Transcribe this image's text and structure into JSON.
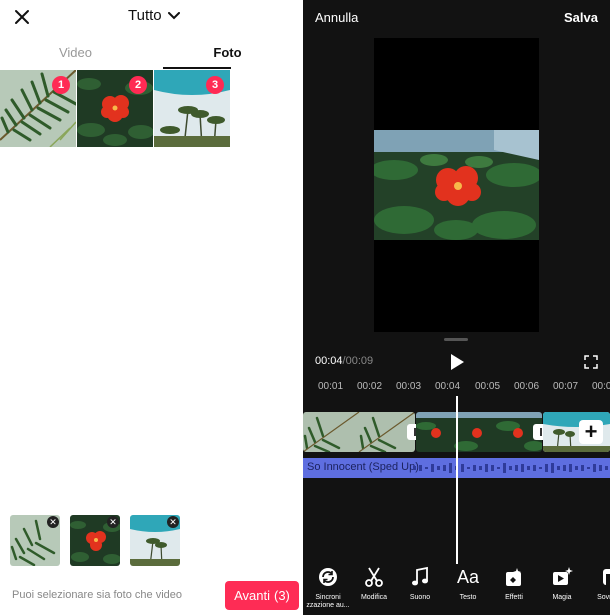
{
  "picker": {
    "album": "Tutto",
    "tabs": [
      {
        "label": "Video",
        "active": false
      },
      {
        "label": "Foto",
        "active": true
      }
    ],
    "photos": [
      {
        "thumb": "palm-leaves",
        "order": "1"
      },
      {
        "thumb": "red-hibiscus",
        "order": "2"
      },
      {
        "thumb": "beach-palms",
        "order": "3"
      }
    ],
    "hint": "Puoi selezionare sia foto che video",
    "next_label": "Avanti",
    "next_count": "(3)",
    "accent": "#fe2c55"
  },
  "editor": {
    "cancel": "Annulla",
    "save": "Salva",
    "time_current": "00:04",
    "time_total": "/00:09",
    "ruler_ticks": [
      "00:01",
      "00:02",
      "00:03",
      "00:04",
      "00:05",
      "00:06",
      "00:07",
      "00:0"
    ],
    "audio_title": "So Innocent (Sped Up)",
    "audio_color": "#5e6ee0",
    "tools": [
      {
        "icon": "sync-icon",
        "label": "Sincroni\nzzazione au..."
      },
      {
        "icon": "scissors-icon",
        "label": "Modifica"
      },
      {
        "icon": "music-note-icon",
        "label": "Suono"
      },
      {
        "icon": "text-icon",
        "label": "Testo",
        "glyph": "Aa"
      },
      {
        "icon": "effects-icon",
        "label": "Effetti"
      },
      {
        "icon": "magic-icon",
        "label": "Magia"
      },
      {
        "icon": "overlay-icon",
        "label": "Sovrim"
      }
    ]
  }
}
